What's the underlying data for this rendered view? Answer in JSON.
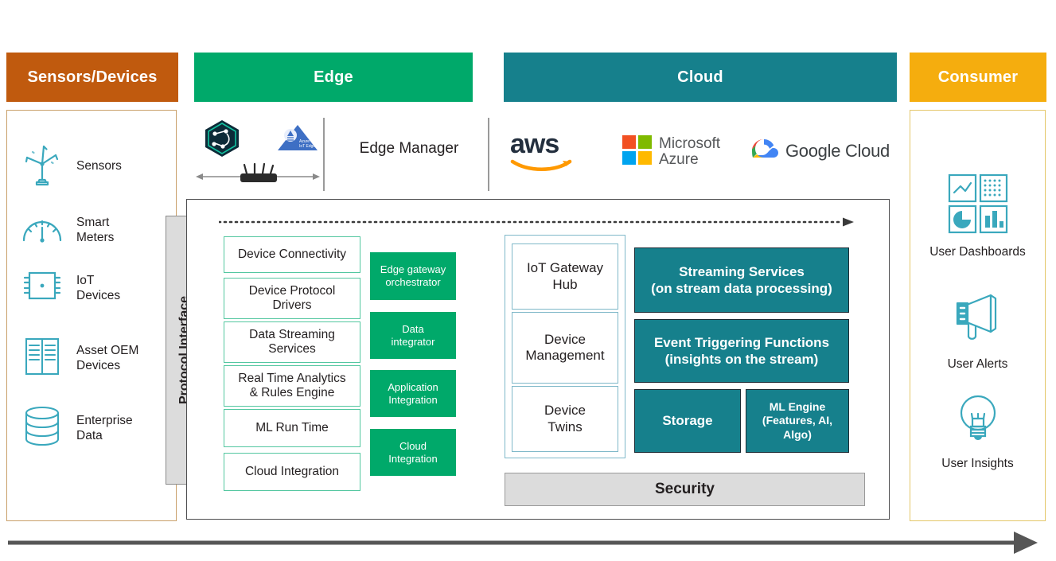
{
  "columns": {
    "sensors": {
      "title": "Sensors/Devices",
      "color": "#c05a0e"
    },
    "edge": {
      "title": "Edge",
      "color": "#00a96a"
    },
    "cloud": {
      "title": "Cloud",
      "color": "#16808c"
    },
    "consumer": {
      "title": "Consumer",
      "color": "#f5ad0e"
    }
  },
  "sensors_panel": {
    "items": [
      {
        "icon": "wind-turbine-icon",
        "label": "Sensors"
      },
      {
        "icon": "gauge-icon",
        "label": "Smart\nMeters"
      },
      {
        "icon": "chip-icon",
        "label": "IoT\nDevices"
      },
      {
        "icon": "book-icon",
        "label": "Asset OEM\nDevices"
      },
      {
        "icon": "database-icon",
        "label": "Enterprise\nData"
      }
    ]
  },
  "protocol_interface": {
    "label": "Protocol Interface"
  },
  "edge_strip": {
    "logos": [
      {
        "icon": "aws-iot-greengrass-icon",
        "name": "AWS IoT Greengrass"
      },
      {
        "icon": "router-icon",
        "name": "Router"
      },
      {
        "icon": "azure-iot-edge-icon",
        "name": "Azure IoT Edge"
      }
    ],
    "manager_label": "Edge Manager"
  },
  "cloud_strip": {
    "logos": [
      {
        "icon": "aws-logo-icon",
        "name": "aws"
      },
      {
        "icon": "microsoft-azure-logo-icon",
        "line1": "Microsoft",
        "line2": "Azure"
      },
      {
        "icon": "google-cloud-logo-icon",
        "name": "Google Cloud"
      }
    ]
  },
  "edge_boxes": [
    {
      "label": "Device Connectivity"
    },
    {
      "label": "Device Protocol\nDrivers"
    },
    {
      "label": "Data Streaming\nServices"
    },
    {
      "label": "Real Time Analytics\n& Rules Engine"
    },
    {
      "label": "ML Run Time"
    },
    {
      "label": "Cloud Integration"
    }
  ],
  "edge_green_boxes": [
    {
      "label": "Edge gateway\norchestrator"
    },
    {
      "label": "Data\nintegrator"
    },
    {
      "label": "Application\nIntegration"
    },
    {
      "label": "Cloud\nIntegration"
    }
  ],
  "gateway_boxes": [
    {
      "label": "IoT Gateway\nHub"
    },
    {
      "label": "Device\nManagement"
    },
    {
      "label": "Device\nTwins"
    }
  ],
  "cloud_service_boxes": [
    {
      "label": "Streaming Services\n(on stream data processing)"
    },
    {
      "label": "Event Triggering Functions\n(insights on the stream)"
    },
    {
      "label": "Storage"
    },
    {
      "label": "ML Engine\n(Features, AI,\nAlgo)"
    }
  ],
  "security": {
    "label": "Security"
  },
  "consumer_panel": {
    "items": [
      {
        "icon": "dashboard-grid-icon",
        "label": "User Dashboards"
      },
      {
        "icon": "megaphone-icon",
        "label": "User Alerts"
      },
      {
        "icon": "lightbulb-icon",
        "label": "User Insights"
      }
    ]
  },
  "flow_arrows": {
    "dotted_arrow": "data-flow-arrow",
    "bottom_arrow": "end-to-end-flow-arrow"
  },
  "palette": {
    "orange": "#c05a0e",
    "green": "#00a96a",
    "teal": "#16808c",
    "amber": "#f5ad0e",
    "icon_teal": "#3aa8bd",
    "gray": "#dcdcdc"
  }
}
